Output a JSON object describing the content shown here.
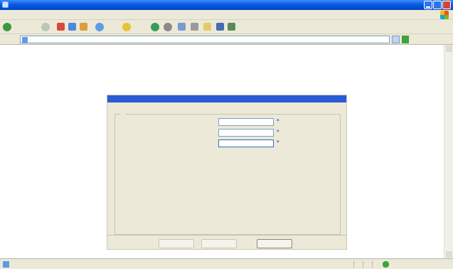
{
  "window": {
    "title": ""
  },
  "menubar": {
    "items": [
      "",
      "",
      "",
      "",
      "",
      ""
    ]
  },
  "toolbar": {
    "icons": [
      "back-icon",
      "forward-icon",
      "stop-icon",
      "refresh-icon",
      "home-icon",
      "search-icon",
      "favorites-icon",
      "media-icon",
      "history-icon",
      "mail-icon",
      "print-icon",
      "edit-icon",
      "discuss-icon",
      "messenger-icon"
    ]
  },
  "addressbar": {
    "label": "",
    "url": "",
    "go_label": "",
    "links_label": ""
  },
  "dialog": {
    "header": "",
    "group_legend": "",
    "fields": [
      {
        "label": "",
        "value": ""
      },
      {
        "label": "",
        "value": ""
      },
      {
        "label": "",
        "value": ""
      }
    ],
    "buttons": {
      "back": "",
      "next": "",
      "cancel": ""
    },
    "accent_color": "#2a5bd7"
  },
  "statusbar": {
    "text": "",
    "zone": ""
  }
}
